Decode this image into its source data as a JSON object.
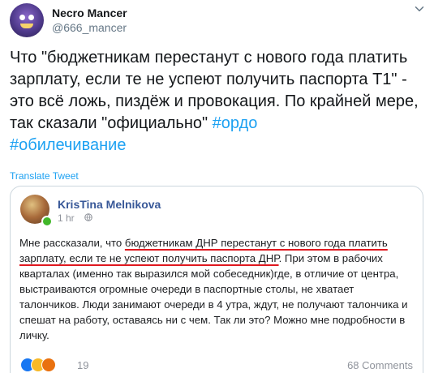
{
  "tweet": {
    "display_name": "Necro Mancer",
    "handle": "@666_mancer",
    "text_parts": [
      "Что \"бюджетникам перестанут с нового года платить зарплату, если те не успеют получить паспорта Т1\" - это всё ложь, пиздёж и провокация. По крайней мере, так сказали \"официально\" ",
      "#ордо",
      " ",
      "#обилечивание"
    ],
    "translate_label": "Translate Tweet"
  },
  "card": {
    "author": "KrisTina Melnikova",
    "time": "1 hr",
    "text_parts": [
      "Мне рассказали, что ",
      "бюджетникам ДНР перестанут с нового года платить зарплату, если те не успеют получить паспорта ДНР",
      ". При этом в рабочих кварталах (именно так выразился мой собеседник)где, в отличие от центра, выстраиваются огромные очереди в паспортные столы, не хватает талончиков. Люди занимают очереди в 4 утра, ждут, не получают талончика и спешат на работу, оставаясь ни с чем. Так ли это? Можно мне подробности в личку."
    ],
    "reaction_count": "19",
    "comments_label": "68 Comments",
    "reaction_icons": [
      "like-icon",
      "haha-icon",
      "angry-icon"
    ]
  },
  "colors": {
    "link": "#1da1f2",
    "fb_name": "#385898",
    "underline": "#e0181f"
  }
}
